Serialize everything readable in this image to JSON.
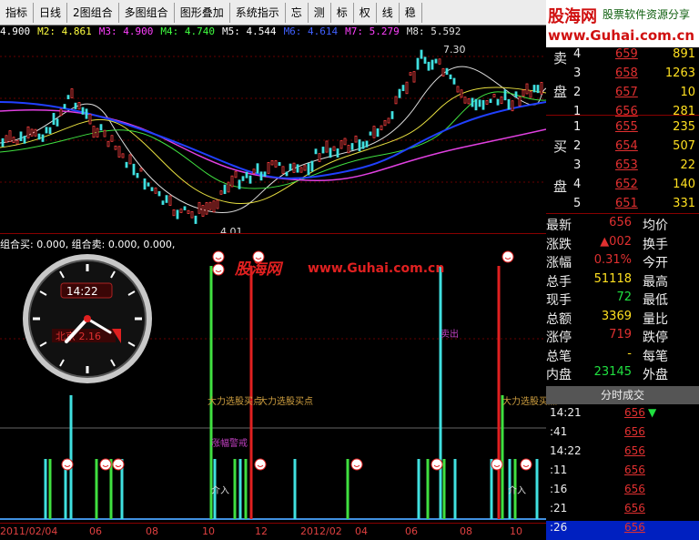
{
  "toolbar": [
    {
      "label": "指标",
      "name": "indicator-button"
    },
    {
      "label": "日线",
      "name": "daily-line-button"
    },
    {
      "label": "2图组合",
      "name": "two-chart-combo-button"
    },
    {
      "label": "多图组合",
      "name": "multi-chart-combo-button"
    },
    {
      "label": "图形叠加",
      "name": "overlay-button"
    },
    {
      "label": "系统指示",
      "name": "system-indicator-button"
    },
    {
      "label": "忘",
      "name": "forget-button"
    },
    {
      "label": "测",
      "name": "measure-button"
    },
    {
      "label": "标",
      "name": "mark-button"
    },
    {
      "label": "权",
      "name": "rights-button"
    },
    {
      "label": "线",
      "name": "line-button"
    },
    {
      "label": "稳",
      "name": "stable-button"
    }
  ],
  "brand": {
    "logo": "股海网",
    "slogan": "股票软件资源分享",
    "url": "www.Guhai.com.cn"
  },
  "ma_line": [
    {
      "text": "4.900",
      "color": "#ffffff"
    },
    {
      "text": "M2: 4.861",
      "color": "#ffff40"
    },
    {
      "text": "M3: 4.900",
      "color": "#ff40ff"
    },
    {
      "text": "M4: 4.740",
      "color": "#40ff40"
    },
    {
      "text": "M5: 4.544",
      "color": "#ffffff"
    },
    {
      "text": "M6: 4.614",
      "color": "#4060ff"
    },
    {
      "text": "M7: 5.279",
      "color": "#ff40ff"
    },
    {
      "text": "M8: 5.592",
      "color": "#e0e0e0"
    }
  ],
  "price_marks": {
    "high": "7.30",
    "low": "4.01"
  },
  "indicator_title": "组合买: 0.000, 组合卖: 0.000, 0.000,",
  "clock": {
    "time": "14:22",
    "label": "北京 2.16"
  },
  "watermark": {
    "logo": "股海网",
    "url": "www.Guhai.com.cn"
  },
  "chart_labels": {
    "buy1": "大力选股买点",
    "buy2": "大力选股买点",
    "buy3": "大力选股买点",
    "trap": "涨幅警戒",
    "sell": "卖出",
    "entry1": "介入",
    "entry2": "介入"
  },
  "x_axis": [
    "2011/02/04",
    "06",
    "08",
    "10",
    "12",
    "2012/02",
    "04",
    "06",
    "08",
    "10"
  ],
  "sell_levels": [
    {
      "side": "卖",
      "idx": "4",
      "price": "659",
      "vol": "891"
    },
    {
      "side": "",
      "idx": "3",
      "price": "658",
      "vol": "1263"
    },
    {
      "side": "盘",
      "idx": "2",
      "price": "657",
      "vol": "10"
    },
    {
      "side": "",
      "idx": "1",
      "price": "656",
      "vol": "281"
    }
  ],
  "buy_levels": [
    {
      "idx": "1",
      "price": "655",
      "vol": "235"
    },
    {
      "idx": "2",
      "price": "654",
      "vol": "507"
    },
    {
      "idx": "3",
      "price": "653",
      "vol": "22"
    },
    {
      "idx": "4",
      "price": "652",
      "vol": "140"
    },
    {
      "idx": "5",
      "price": "651",
      "vol": "331"
    }
  ],
  "buy_side": [
    "买",
    "盘"
  ],
  "stats": [
    {
      "l": "最新",
      "v": "656",
      "vc": "#e03030",
      "l2": "均价"
    },
    {
      "l": "涨跌",
      "v": "▲002",
      "vc": "#e03030",
      "l2": "换手"
    },
    {
      "l": "涨幅",
      "v": "0.31%",
      "vc": "#e03030",
      "l2": "今开"
    },
    {
      "l": "总手",
      "v": "51118",
      "vc": "#ffe020",
      "l2": "最高"
    },
    {
      "l": "现手",
      "v": "72",
      "vc": "#20e040",
      "l2": "最低"
    },
    {
      "l": "总额",
      "v": "3369",
      "vc": "#ffe020",
      "l2": "量比"
    },
    {
      "l": "涨停",
      "v": "719",
      "vc": "#e03030",
      "l2": "跌停"
    },
    {
      "l": "总笔",
      "v": "-",
      "vc": "#ffe020",
      "l2": "每笔"
    },
    {
      "l": "内盘",
      "v": "23145",
      "vc": "#20e040",
      "l2": "外盘"
    }
  ],
  "ticks_header": "分时成交",
  "ticks": [
    {
      "t": "14:21",
      "p": "656",
      "down": "▼"
    },
    {
      "t": ":41",
      "p": "656",
      "down": ""
    },
    {
      "t": "14:22",
      "p": "656",
      "down": ""
    },
    {
      "t": ":11",
      "p": "656",
      "down": ""
    },
    {
      "t": ":16",
      "p": "656",
      "down": ""
    },
    {
      "t": ":21",
      "p": "656",
      "down": ""
    },
    {
      "t": ":26",
      "p": "656",
      "down": ""
    }
  ]
}
